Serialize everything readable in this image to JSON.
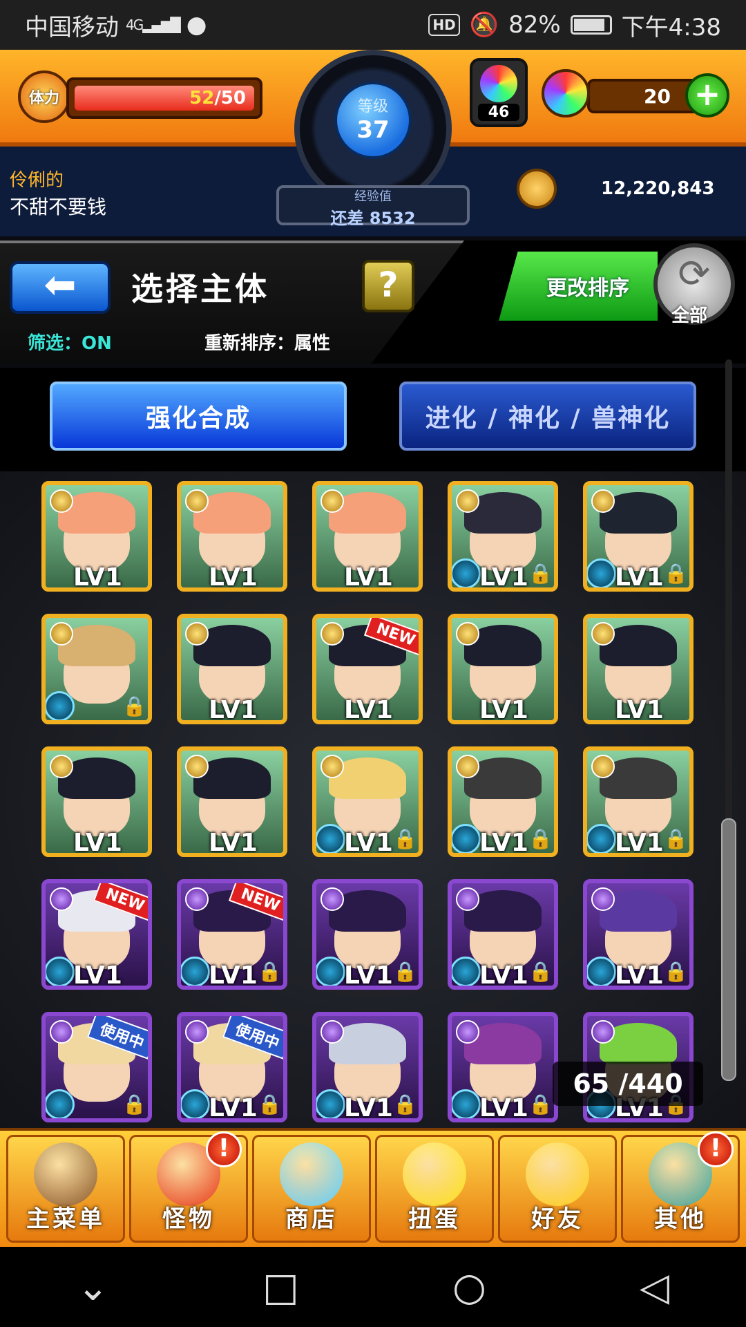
{
  "status_bar": {
    "carrier": "中国移动",
    "network": "4G",
    "hd": "HD",
    "battery": "82%",
    "time": "下午4:38"
  },
  "header": {
    "stamina_label": "体力",
    "stamina_current": "52",
    "stamina_max": "/50",
    "level_label": "等级",
    "level": "37",
    "exp_label": "经验值",
    "exp_remaining": "还差 8532",
    "gem_count": "46",
    "orb_count": "20",
    "player_title": "伶俐的",
    "player_name": "不甜不要钱",
    "gold": "12,220,843"
  },
  "panel": {
    "title": "选择主体",
    "help": "?",
    "filter": "筛选：ON",
    "sort_info": "重新排序：属性",
    "sort_button": "更改排序",
    "all_label": "全部"
  },
  "tabs": {
    "strengthen": "强化合成",
    "evolve": "进化 / 神化 / 兽神化"
  },
  "monsters": [
    [
      {
        "lv": "LV1",
        "frame": "gold",
        "hair": "#f6a07a",
        "orb": false,
        "lock": false,
        "badge": ""
      },
      {
        "lv": "LV1",
        "frame": "gold",
        "hair": "#f6a07a",
        "orb": false,
        "lock": false,
        "badge": ""
      },
      {
        "lv": "LV1",
        "frame": "gold",
        "hair": "#f6a07a",
        "orb": false,
        "lock": false,
        "badge": ""
      },
      {
        "lv": "LV1",
        "frame": "gold",
        "hair": "#2a2a3a",
        "orb": true,
        "lock": true,
        "badge": ""
      },
      {
        "lv": "LV1",
        "frame": "gold",
        "hair": "#1e2430",
        "orb": true,
        "lock": true,
        "badge": ""
      }
    ],
    [
      {
        "lv": "",
        "frame": "gold",
        "hair": "#d8b070",
        "orb": true,
        "lock": true,
        "badge": ""
      },
      {
        "lv": "LV1",
        "frame": "gold",
        "hair": "#1c1e2e",
        "orb": false,
        "lock": false,
        "badge": ""
      },
      {
        "lv": "LV1",
        "frame": "gold",
        "hair": "#1c1e2e",
        "orb": false,
        "lock": false,
        "badge": "NEW"
      },
      {
        "lv": "LV1",
        "frame": "gold",
        "hair": "#1c1e2e",
        "orb": false,
        "lock": false,
        "badge": ""
      },
      {
        "lv": "LV1",
        "frame": "gold",
        "hair": "#1c1e2e",
        "orb": false,
        "lock": false,
        "badge": ""
      }
    ],
    [
      {
        "lv": "LV1",
        "frame": "gold",
        "hair": "#1c1e2e",
        "orb": false,
        "lock": false,
        "badge": ""
      },
      {
        "lv": "LV1",
        "frame": "gold",
        "hair": "#1c1e2e",
        "orb": false,
        "lock": false,
        "badge": ""
      },
      {
        "lv": "LV1",
        "frame": "gold",
        "hair": "#f0d070",
        "orb": true,
        "lock": true,
        "badge": ""
      },
      {
        "lv": "LV1",
        "frame": "gold",
        "hair": "#3a3a3a",
        "orb": true,
        "lock": true,
        "badge": ""
      },
      {
        "lv": "LV1",
        "frame": "gold",
        "hair": "#3a3a3a",
        "orb": true,
        "lock": true,
        "badge": ""
      }
    ],
    [
      {
        "lv": "LV1",
        "frame": "purple",
        "hair": "#e8e8f0",
        "orb": true,
        "lock": false,
        "badge": "NEW"
      },
      {
        "lv": "LV1",
        "frame": "purple",
        "hair": "#2a1a4a",
        "orb": true,
        "lock": true,
        "badge": "NEW"
      },
      {
        "lv": "LV1",
        "frame": "purple",
        "hair": "#2a1a4a",
        "orb": true,
        "lock": true,
        "badge": ""
      },
      {
        "lv": "LV1",
        "frame": "purple",
        "hair": "#2a1a4a",
        "orb": true,
        "lock": true,
        "badge": ""
      },
      {
        "lv": "LV1",
        "frame": "purple",
        "hair": "#5a3aa0",
        "orb": true,
        "lock": true,
        "badge": ""
      }
    ],
    [
      {
        "lv": "",
        "frame": "purple",
        "hair": "#f0d8a0",
        "orb": true,
        "lock": true,
        "badge": "使用中"
      },
      {
        "lv": "LV1",
        "frame": "purple",
        "hair": "#f0d8a0",
        "orb": true,
        "lock": true,
        "badge": "使用中"
      },
      {
        "lv": "LV1",
        "frame": "purple",
        "hair": "#c8d0e0",
        "orb": true,
        "lock": true,
        "badge": ""
      },
      {
        "lv": "LV1",
        "frame": "purple",
        "hair": "#8a3aa0",
        "orb": true,
        "lock": true,
        "badge": ""
      },
      {
        "lv": "LV1",
        "frame": "purple",
        "hair": "#7ad040",
        "orb": true,
        "lock": true,
        "badge": ""
      }
    ]
  ],
  "counter": "65 /440",
  "bottom_nav": [
    {
      "label": "主菜单",
      "icon": "gate-icon",
      "color": "#8a5a2a",
      "alert": false
    },
    {
      "label": "怪物",
      "icon": "monster-icon",
      "color": "#e83a1a",
      "alert": true
    },
    {
      "label": "商店",
      "icon": "orb-icon",
      "color": "#5ad0ff",
      "alert": false
    },
    {
      "label": "扭蛋",
      "icon": "egg-icon",
      "color": "#ffe21a",
      "alert": false
    },
    {
      "label": "好友",
      "icon": "friends-icon",
      "color": "#ffd21a",
      "alert": false
    },
    {
      "label": "其他",
      "icon": "other-icon",
      "color": "#3aa6a0",
      "alert": true
    }
  ],
  "alert_symbol": "!"
}
